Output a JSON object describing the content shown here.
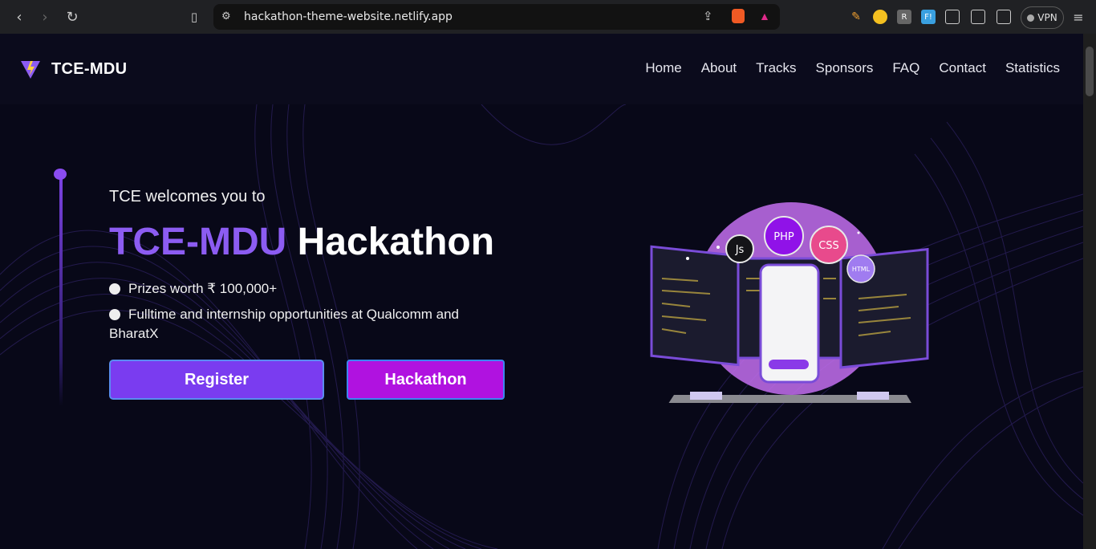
{
  "browser": {
    "url": "hackathon-theme-website.netlify.app",
    "vpn_label": "VPN"
  },
  "site": {
    "brand": "TCE-MDU",
    "nav": [
      "Home",
      "About",
      "Tracks",
      "Sponsors",
      "FAQ",
      "Contact",
      "Statistics"
    ]
  },
  "hero": {
    "welcome": "TCE welcomes you to",
    "title_part1": "TCE-MDU",
    "title_part2": "Hackathon",
    "bullets": [
      "Prizes worth ₹ 100,000+",
      "Fulltime and internship opportunities at Qualcomm and BharatX"
    ],
    "register_label": "Register",
    "hackathon_label": "Hackathon"
  },
  "illustration": {
    "badges": [
      "Js",
      "PHP",
      "CSS",
      "HTML"
    ]
  },
  "colors": {
    "accent": "#8c5cf2",
    "register_bg": "#7a3cf0",
    "hackathon_bg": "#b012e0"
  }
}
